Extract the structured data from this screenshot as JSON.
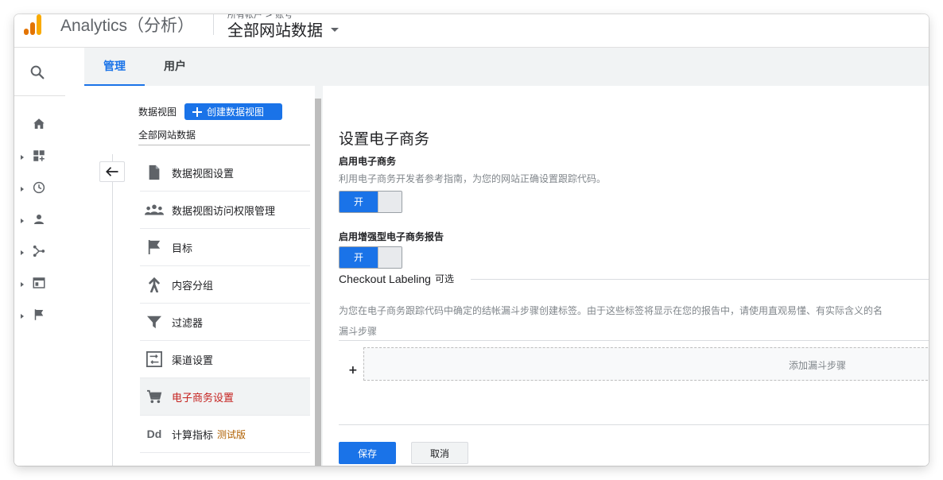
{
  "app": {
    "title": "Analytics（分析）",
    "logo_icon": "analytics-logo-icon",
    "brand_colors": [
      "#f9ab00",
      "#e37400"
    ]
  },
  "header": {
    "crumb": "所有帐户 > 账号",
    "view_name": "全部网站数据"
  },
  "tabs": [
    {
      "label": "管理",
      "active": true
    },
    {
      "label": "用户",
      "active": false
    }
  ],
  "rail": {
    "icons": [
      "search-icon",
      "home-icon",
      "customization-icon",
      "realtime-icon",
      "audience-icon",
      "acquisition-icon",
      "behavior-icon",
      "conversions-icon"
    ]
  },
  "nav": {
    "section_label": "数据视图",
    "create_label": "创建数据视图",
    "view_name": "全部网站数据",
    "items": [
      {
        "label": "数据视图设置",
        "icon": "document-icon"
      },
      {
        "label": "数据视图访问权限管理",
        "icon": "people-icon"
      },
      {
        "label": "目标",
        "icon": "flag-icon"
      },
      {
        "label": "内容分组",
        "icon": "content-grouping-icon"
      },
      {
        "label": "过滤器",
        "icon": "filter-icon"
      },
      {
        "label": "渠道设置",
        "icon": "channel-settings-icon"
      },
      {
        "label": "电子商务设置",
        "icon": "cart-icon",
        "active": true
      },
      {
        "label": "计算指标",
        "icon": "calculated-metrics-icon",
        "badge": "测试版"
      }
    ]
  },
  "panel": {
    "title": "设置电子商务",
    "ecommerce_label": "启用电子商务",
    "ecommerce_help": "利用电子商务开发者参考指南，为您的网站正确设置跟踪代码。",
    "toggle_on_label": "开",
    "enhanced_label": "启用增强型电子商务报告",
    "checkout_title": "Checkout Labeling",
    "checkout_optional": "可选",
    "checkout_help": "为您在电子商务跟踪代码中确定的结帐漏斗步骤创建标签。由于这些标签将显示在您的报告中，请使用直观易懂、有实际含义的名",
    "funnel_label": "漏斗步骤",
    "add_plus": "+",
    "add_step": "添加漏斗步骤",
    "save_label": "保存",
    "cancel_label": "取消"
  },
  "colors": {
    "accent": "#1a73e8",
    "active_nav_text": "#c5221f",
    "beta_text": "#b06000"
  }
}
